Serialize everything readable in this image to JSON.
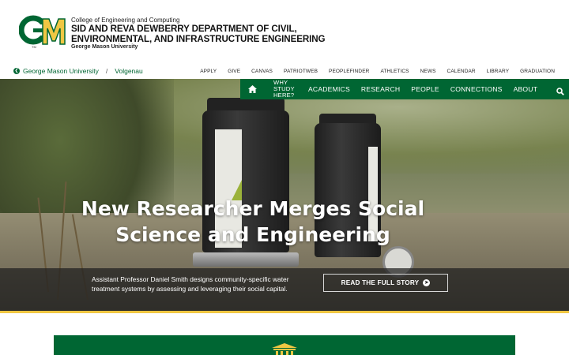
{
  "header": {
    "college": "College of Engineering and Computing",
    "department_line1": "SID AND REVA DEWBERRY DEPARTMENT OF CIVIL,",
    "department_line2": "ENVIRONMENTAL, AND INFRASTRUCTURE ENGINEERING",
    "university": "George Mason University",
    "logo_icon": "gmu-gm-logo",
    "logo_tm": "TM"
  },
  "breadcrumb": {
    "home": "George Mason University",
    "separator": "/",
    "current": "Volgenau"
  },
  "utility_links": [
    "APPLY",
    "GIVE",
    "CANVAS",
    "PATRIOTWEB",
    "PEOPLEFINDER",
    "ATHLETICS",
    "NEWS",
    "CALENDAR",
    "LIBRARY",
    "GRADUATION"
  ],
  "nav": {
    "home_icon": "home-icon",
    "why_line1": "WHY",
    "why_line2": "STUDY",
    "why_line3": "HERE?",
    "items": [
      "ACADEMICS",
      "RESEARCH",
      "PEOPLE",
      "CONNECTIONS",
      "ABOUT"
    ],
    "search_icon": "search-icon"
  },
  "hero": {
    "title_line1": "New Researcher Merges Social",
    "title_line2": "Science and Engineering",
    "description": "Assistant Professor Daniel Smith designs community-specific water treatment systems by assessing and leveraging their social capital.",
    "button_label": "READ THE FULL STORY",
    "button_icon": "arrow-circle-right-icon"
  },
  "lower": {
    "icon": "building-icon"
  },
  "colors": {
    "brand_green": "#006633",
    "brand_gold": "#f0c743"
  }
}
